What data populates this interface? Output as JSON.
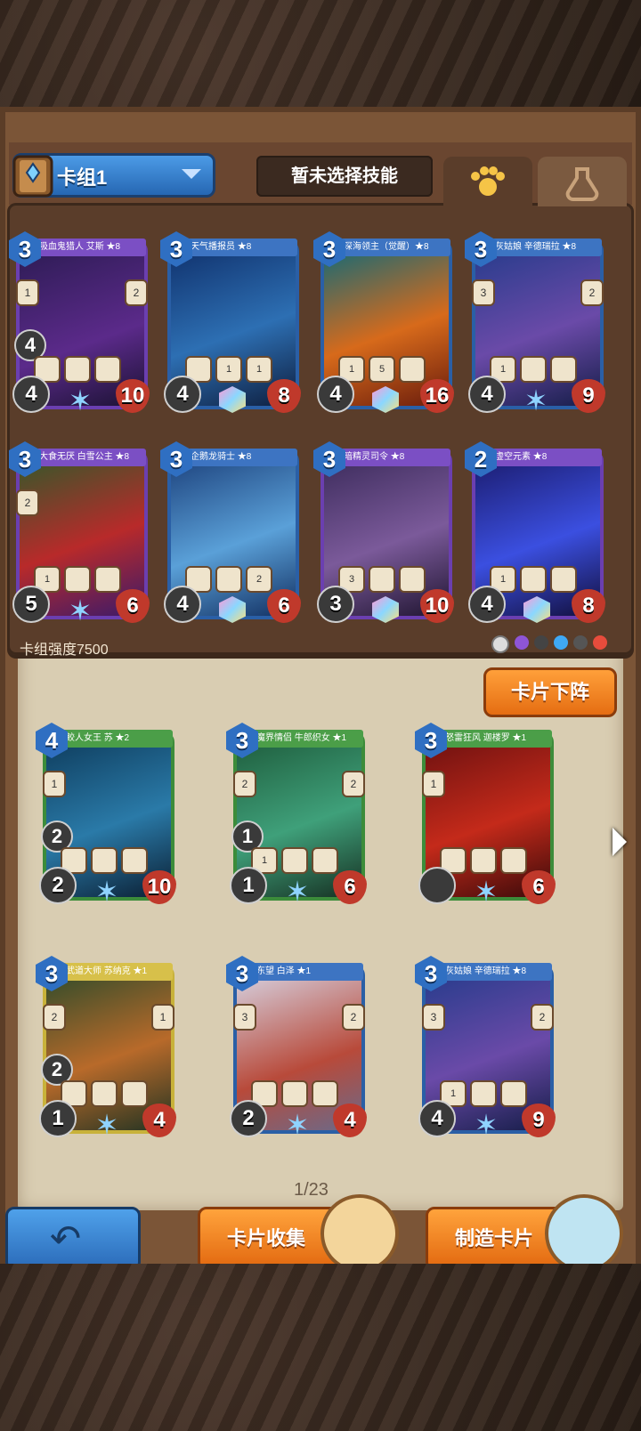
{
  "deck": {
    "name": "卡组1",
    "skill_placeholder": "暂未选择技能",
    "power_label": "卡组强度7500"
  },
  "buttons": {
    "remove": "卡片下阵",
    "collect": "卡片收集",
    "craft": "制造卡片"
  },
  "page": "1/23",
  "deck_cards": [
    {
      "name": "吸血鬼猎人 艾斯 ★8",
      "cost": "3",
      "left": "1",
      "right": "2",
      "level": "4",
      "attack": "4",
      "hp": "10"
    },
    {
      "name": "天气播报员 ★8",
      "cost": "3",
      "s1": "",
      "s2": "1",
      "s3": "1",
      "attack": "4",
      "hp": "8"
    },
    {
      "name": "深海领主（觉醒）★8",
      "cost": "3",
      "s1": "1",
      "s2": "5",
      "attack": "4",
      "hp": "16"
    },
    {
      "name": "灰姑娘 辛德瑞拉 ★8",
      "cost": "3",
      "left": "3",
      "right": "2",
      "s1": "1",
      "attack": "4",
      "hp": "9"
    },
    {
      "name": "大食无厌 白雪公主 ★8",
      "cost": "3",
      "left": "2",
      "s1": "1",
      "attack": "5",
      "hp": "6"
    },
    {
      "name": "企鹅龙骑士 ★8",
      "cost": "3",
      "s3": "2",
      "attack": "4",
      "hp": "6"
    },
    {
      "name": "暗精灵司令 ★8",
      "cost": "3",
      "s1": "3",
      "attack": "3",
      "hp": "10"
    },
    {
      "name": "虚空元素 ★8",
      "cost": "2",
      "s1": "1",
      "attack": "4",
      "hp": "8"
    }
  ],
  "collection_cards": [
    {
      "name": "鲛人女王 苏 ★2",
      "cost": "4",
      "left": "1",
      "level": "2",
      "attack": "2",
      "hp": "10"
    },
    {
      "name": "魔界情侣 牛郎织女 ★1",
      "cost": "3",
      "left": "2",
      "right": "2",
      "level": "1",
      "s1": "1",
      "attack": "1",
      "hp": "6"
    },
    {
      "name": "怒雷狂风 迦楼罗 ★1",
      "cost": "3",
      "left": "1",
      "attack": "",
      "hp": "6"
    },
    {
      "name": "武道大师 苏纳克 ★1",
      "cost": "3",
      "left": "2",
      "right": "1",
      "level": "2",
      "attack": "1",
      "hp": "4"
    },
    {
      "name": "东望 白泽 ★1",
      "cost": "3",
      "left": "3",
      "right": "2",
      "attack": "2",
      "hp": "4"
    },
    {
      "name": "灰姑娘 辛德瑞拉 ★8",
      "cost": "3",
      "left": "3",
      "right": "2",
      "s1": "1",
      "attack": "4",
      "hp": "9"
    }
  ],
  "colors": {
    "card_blue": "#2f6fc2",
    "card_purple": "#6a3fb0",
    "card_green": "#3c8c3a",
    "orange": "#e56d12"
  }
}
